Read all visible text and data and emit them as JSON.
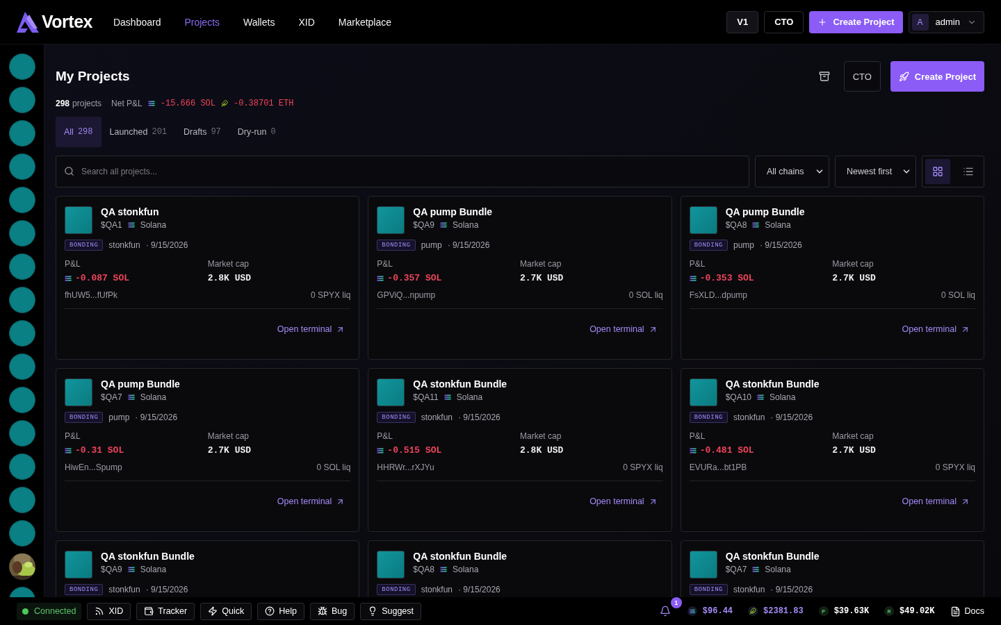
{
  "brand": "Vortex",
  "nav": [
    {
      "label": "Dashboard",
      "selected": false
    },
    {
      "label": "Projects",
      "selected": true
    },
    {
      "label": "Wallets",
      "selected": false
    },
    {
      "label": "XID",
      "selected": false
    },
    {
      "label": "Marketplace",
      "selected": false
    }
  ],
  "top_actions": {
    "version": "V1",
    "cto": "CTO",
    "create": "Create Project",
    "user_initial": "A",
    "user": "admin"
  },
  "sidebar": {
    "items": [
      {
        "kind": "token"
      },
      {
        "kind": "token"
      },
      {
        "kind": "token"
      },
      {
        "kind": "token"
      },
      {
        "kind": "token"
      },
      {
        "kind": "token"
      },
      {
        "kind": "token"
      },
      {
        "kind": "token"
      },
      {
        "kind": "token"
      },
      {
        "kind": "token"
      },
      {
        "kind": "token"
      },
      {
        "kind": "token"
      },
      {
        "kind": "token"
      },
      {
        "kind": "token"
      },
      {
        "kind": "token"
      },
      {
        "kind": "picture"
      },
      {
        "kind": "token"
      }
    ]
  },
  "page": {
    "title": "My Projects",
    "cto": "CTO",
    "create": "Create Project"
  },
  "summary": {
    "count": "298",
    "count_label": "projects",
    "pnl_label": "Net P&L",
    "sol": "-15.666 SOL",
    "eth": "-0.38701 ETH"
  },
  "tabs": [
    {
      "label": "All",
      "count": "298",
      "selected": true
    },
    {
      "label": "Launched",
      "count": "201",
      "selected": false
    },
    {
      "label": "Drafts",
      "count": "97",
      "selected": false
    },
    {
      "label": "Dry-run",
      "count": "0",
      "selected": false
    }
  ],
  "search": {
    "placeholder": "Search all projects..."
  },
  "filters": {
    "chain": "All chains",
    "sort": "Newest first"
  },
  "view": {
    "grid_selected": true
  },
  "projects": [
    {
      "name": "QA stonkfun",
      "ticker": "$QA1",
      "chain": "Solana",
      "status": "BONDING",
      "platform": "stonkfun",
      "date": "· 9/15/2026",
      "pnl_label": "P&L",
      "pnl": "-0.087 SOL",
      "cap_label": "Market cap",
      "cap": "2.8K USD",
      "address": "fhUW5...fUfPk",
      "liq": "0 SPYX liq",
      "link": "Open terminal"
    },
    {
      "name": "QA pump Bundle",
      "ticker": "$QA9",
      "chain": "Solana",
      "status": "BONDING",
      "platform": "pump",
      "date": "· 9/15/2026",
      "pnl_label": "P&L",
      "pnl": "-0.357 SOL",
      "cap_label": "Market cap",
      "cap": "2.7K USD",
      "address": "GPViQ...npump",
      "liq": "0 SOL liq",
      "link": "Open terminal"
    },
    {
      "name": "QA pump Bundle",
      "ticker": "$QA8",
      "chain": "Solana",
      "status": "BONDING",
      "platform": "pump",
      "date": "· 9/15/2026",
      "pnl_label": "P&L",
      "pnl": "-0.353 SOL",
      "cap_label": "Market cap",
      "cap": "2.7K USD",
      "address": "FsXLD...dpump",
      "liq": "0 SOL liq",
      "link": "Open terminal"
    },
    {
      "name": "QA pump Bundle",
      "ticker": "$QA7",
      "chain": "Solana",
      "status": "BONDING",
      "platform": "pump",
      "date": "· 9/15/2026",
      "pnl_label": "P&L",
      "pnl": "-0.31 SOL",
      "cap_label": "Market cap",
      "cap": "2.7K USD",
      "address": "HiwEn...Spump",
      "liq": "0 SOL liq",
      "link": "Open terminal"
    },
    {
      "name": "QA stonkfun Bundle",
      "ticker": "$QA11",
      "chain": "Solana",
      "status": "BONDING",
      "platform": "stonkfun",
      "date": "· 9/15/2026",
      "pnl_label": "P&L",
      "pnl": "-0.515 SOL",
      "cap_label": "Market cap",
      "cap": "2.8K USD",
      "address": "HHRWr...rXJYu",
      "liq": "0 SPYX liq",
      "link": "Open terminal"
    },
    {
      "name": "QA stonkfun Bundle",
      "ticker": "$QA10",
      "chain": "Solana",
      "status": "BONDING",
      "platform": "stonkfun",
      "date": "· 9/15/2026",
      "pnl_label": "P&L",
      "pnl": "-0.481 SOL",
      "cap_label": "Market cap",
      "cap": "2.7K USD",
      "address": "EVURa...bt1PB",
      "liq": "0 SPYX liq",
      "link": "Open terminal"
    },
    {
      "name": "QA stonkfun Bundle",
      "ticker": "$QA9",
      "chain": "Solana",
      "status": "BONDING",
      "platform": "stonkfun",
      "date": "· 9/15/2026"
    },
    {
      "name": "QA stonkfun Bundle",
      "ticker": "$QA8",
      "chain": "Solana",
      "status": "BONDING",
      "platform": "stonkfun",
      "date": "· 9/15/2026"
    },
    {
      "name": "QA stonkfun Bundle",
      "ticker": "$QA7",
      "chain": "Solana",
      "status": "BONDING",
      "platform": "stonkfun",
      "date": "· 9/15/2026"
    }
  ],
  "status_bar": {
    "connection": "Connected",
    "connected": true,
    "buttons": [
      {
        "kind": "rss",
        "label": "XID"
      },
      {
        "kind": "wallet",
        "label": "Tracker"
      },
      {
        "kind": "zap",
        "label": "Quick"
      },
      {
        "kind": "help",
        "label": "Help"
      },
      {
        "kind": "bug",
        "label": "Bug"
      },
      {
        "kind": "bulb",
        "label": "Suggest"
      }
    ],
    "notifications": "1",
    "prices": [
      {
        "kind": "sol",
        "value": "$96.44"
      },
      {
        "kind": "eth",
        "value": "$2381.83"
      },
      {
        "kind": "letter",
        "letter": "P",
        "value": "$39.63K"
      },
      {
        "kind": "letter",
        "letter": "R",
        "value": "$49.02K"
      }
    ],
    "docs": "Docs"
  }
}
